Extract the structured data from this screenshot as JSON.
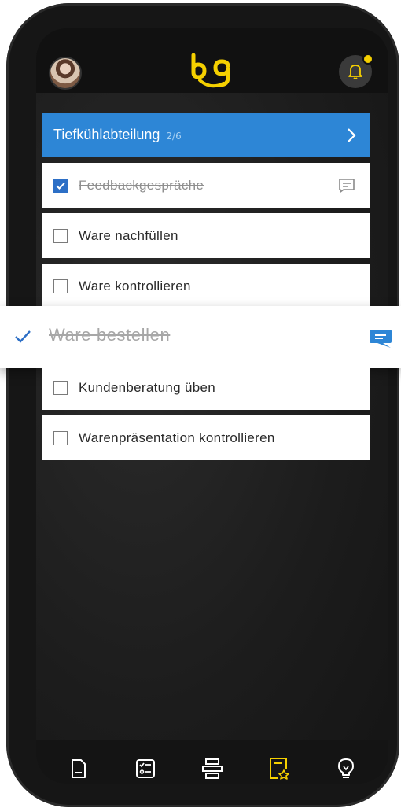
{
  "notifications": {
    "has_unread": true
  },
  "section": {
    "title": "Tiefkühlabteilung",
    "count": "2/6"
  },
  "tasks": [
    {
      "label": "Feedbackgespräche",
      "done": true,
      "has_comment": true
    },
    {
      "label": "Ware nachfüllen",
      "done": false
    },
    {
      "label": "Ware kontrollieren",
      "done": false
    },
    {
      "label": "Ware bestellen",
      "done": true,
      "has_comment": true
    },
    {
      "label": "Kundenberatung üben",
      "done": false
    },
    {
      "label": "Warenpräsentation kontrollieren",
      "done": false
    }
  ],
  "tabs": [
    "document-icon",
    "checklist-icon",
    "hierarchy-icon",
    "favorites-icon",
    "lightbulb-icon"
  ],
  "colors": {
    "accent": "#2d86d6",
    "brand": "#f5d000",
    "active_tab": "#f5d000"
  }
}
